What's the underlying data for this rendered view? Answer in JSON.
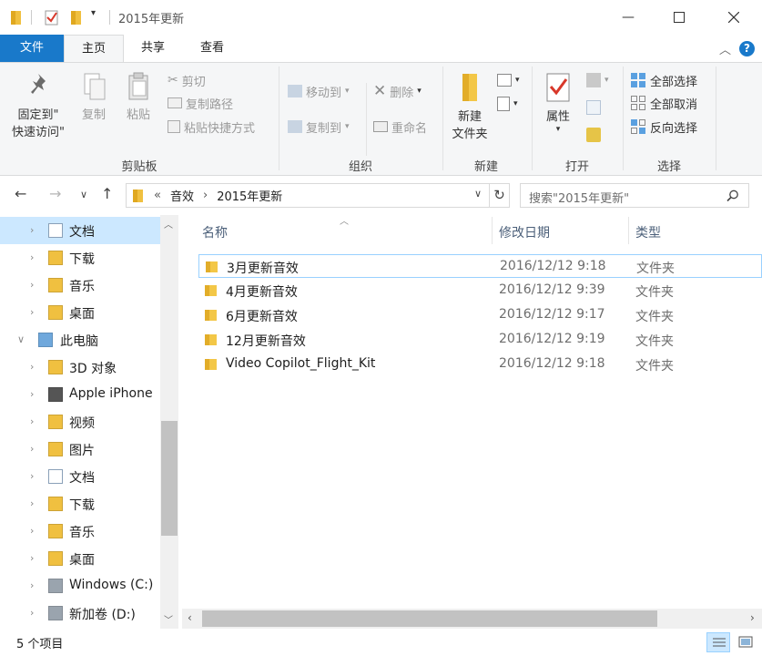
{
  "window": {
    "title": "2015年更新",
    "controls": [
      "minimize-icon",
      "maximize-icon",
      "close-icon"
    ]
  },
  "quick_access": {
    "icons": [
      "folder-icon",
      "properties-check-icon",
      "new-folder-icon",
      "customize-dropdown-icon"
    ]
  },
  "ribbon": {
    "tabs": [
      {
        "label": "文件"
      },
      {
        "label": "主页"
      },
      {
        "label": "共享"
      },
      {
        "label": "查看"
      }
    ],
    "clipboard": {
      "pin_label_1": "固定到\"",
      "pin_label_2": "快速访问\"",
      "copy_label": "复制",
      "paste_label": "粘贴",
      "cut_label": "剪切",
      "copy_path_label": "复制路径",
      "paste_shortcut_label": "粘贴快捷方式",
      "group_label": "剪贴板"
    },
    "organize": {
      "move_to_label": "移动到",
      "copy_to_label": "复制到",
      "delete_label": "删除",
      "rename_label": "重命名",
      "group_label": "组织"
    },
    "new": {
      "new_folder_label_1": "新建",
      "new_folder_label_2": "文件夹",
      "group_label": "新建"
    },
    "open": {
      "properties_label": "属性",
      "group_label": "打开"
    },
    "select": {
      "select_all_label": "全部选择",
      "select_none_label": "全部取消",
      "invert_label": "反向选择",
      "group_label": "选择"
    },
    "colors": {
      "file_tab": "#1979ca",
      "ribbon_bg": "#f5f6f7"
    }
  },
  "address": {
    "overflow": "«",
    "crumbs": [
      "音效",
      "2015年更新"
    ],
    "search_placeholder": "搜索\"2015年更新\""
  },
  "nav_pane": {
    "items": [
      {
        "label": "文档",
        "icon": "documents-icon",
        "selected": true
      },
      {
        "label": "下载",
        "icon": "downloads-icon"
      },
      {
        "label": "音乐",
        "icon": "music-icon"
      },
      {
        "label": "桌面",
        "icon": "desktop-icon"
      },
      {
        "label": "此电脑",
        "icon": "this-pc-icon",
        "expanded": true
      },
      {
        "label": "3D 对象",
        "icon": "3d-objects-icon"
      },
      {
        "label": "Apple iPhone",
        "icon": "iphone-icon"
      },
      {
        "label": "视频",
        "icon": "videos-icon"
      },
      {
        "label": "图片",
        "icon": "pictures-icon"
      },
      {
        "label": "文档",
        "icon": "documents-icon"
      },
      {
        "label": "下载",
        "icon": "downloads-icon"
      },
      {
        "label": "音乐",
        "icon": "music-icon"
      },
      {
        "label": "桌面",
        "icon": "desktop-icon"
      },
      {
        "label": "Windows (C:)",
        "icon": "drive-c-icon"
      },
      {
        "label": "新加卷 (D:)",
        "icon": "drive-d-icon"
      }
    ]
  },
  "columns": {
    "name": "名称",
    "modified": "修改日期",
    "type": "类型"
  },
  "files": [
    {
      "name": "3月更新音效",
      "modified": "2016/12/12 9:18",
      "type": "文件夹"
    },
    {
      "name": "4月更新音效",
      "modified": "2016/12/12 9:39",
      "type": "文件夹"
    },
    {
      "name": "6月更新音效",
      "modified": "2016/12/12 9:17",
      "type": "文件夹"
    },
    {
      "name": "12月更新音效",
      "modified": "2016/12/12 9:19",
      "type": "文件夹"
    },
    {
      "name": "Video Copilot_Flight_Kit",
      "modified": "2016/12/12 9:18",
      "type": "文件夹"
    }
  ],
  "status": {
    "item_count": "5 个项目"
  }
}
